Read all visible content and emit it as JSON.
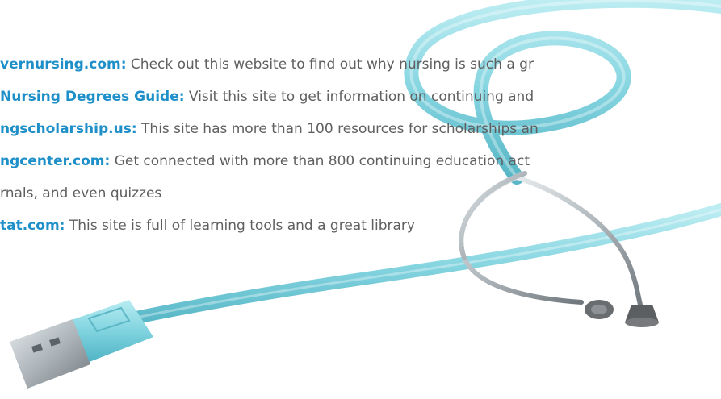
{
  "items": [
    {
      "link": "vernursing.com:",
      "text": " Check out this website to find out why nursing is such a gr"
    },
    {
      "link": "Nursing Degrees Guide:",
      "text": " Visit this site to get information on continuing and"
    },
    {
      "link": "ngscholarship.us:",
      "text": " This site has more than 100 resources for scholarships an"
    },
    {
      "link": "ngcenter.com:",
      "text": " Get connected with more than 800 continuing education act"
    },
    {
      "continuation": "rnals, and even quizzes"
    },
    {
      "link": "tat.com:",
      "text": " This site is full of learning tools and a great library"
    }
  ],
  "art": {
    "tube_color": "#7fd3df",
    "tube_shade": "#56b9c9",
    "metal_color": "#9aa3a8",
    "background": "#ffffff"
  }
}
